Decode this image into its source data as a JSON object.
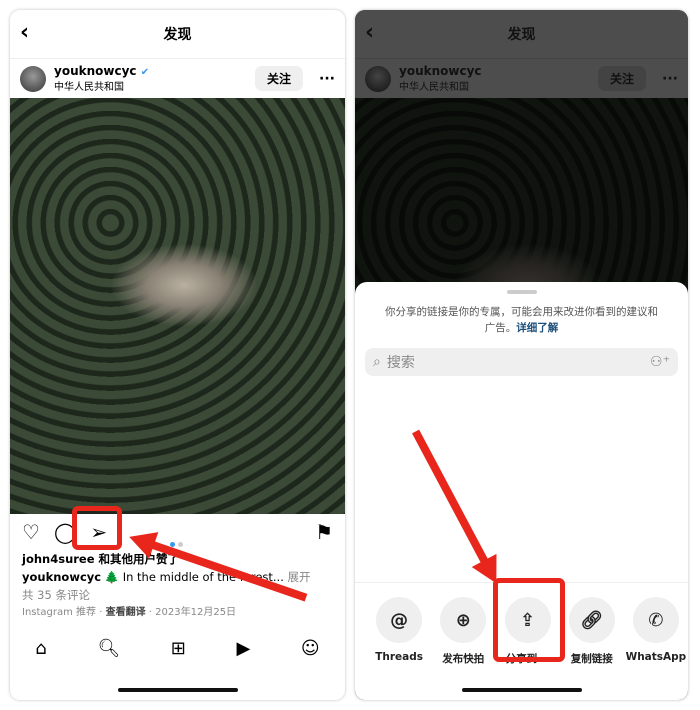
{
  "left": {
    "title": "发现",
    "username": "youknowcyc",
    "location": "中华人民共和国",
    "follow": "关注",
    "likes": "john4suree 和其他用户赞了",
    "caption_user": "youknowcyc",
    "caption": "🌲 In the middle of the forest...",
    "expand": "展开",
    "comments": "共 35 条评论",
    "source": "Instagram 推荐",
    "translate": "查看翻译",
    "date": "2023年12月25日"
  },
  "right": {
    "title": "发现",
    "username": "youknowcyc",
    "location": "中华人民共和国",
    "follow": "关注",
    "notice": "你分享的链接是你的专属，可能会用来改进你看到的建议和广告。",
    "learn_more": "详细了解",
    "search_placeholder": "搜索",
    "share_options": [
      {
        "label": "Threads",
        "icon": "threads-icon"
      },
      {
        "label": "发布快拍",
        "icon": "add-story-icon"
      },
      {
        "label": "分享到...",
        "icon": "share-up-icon"
      },
      {
        "label": "复制链接",
        "icon": "link-icon"
      },
      {
        "label": "WhatsApp",
        "icon": "whatsapp-icon"
      }
    ]
  },
  "annotation_color": "#e8261b"
}
